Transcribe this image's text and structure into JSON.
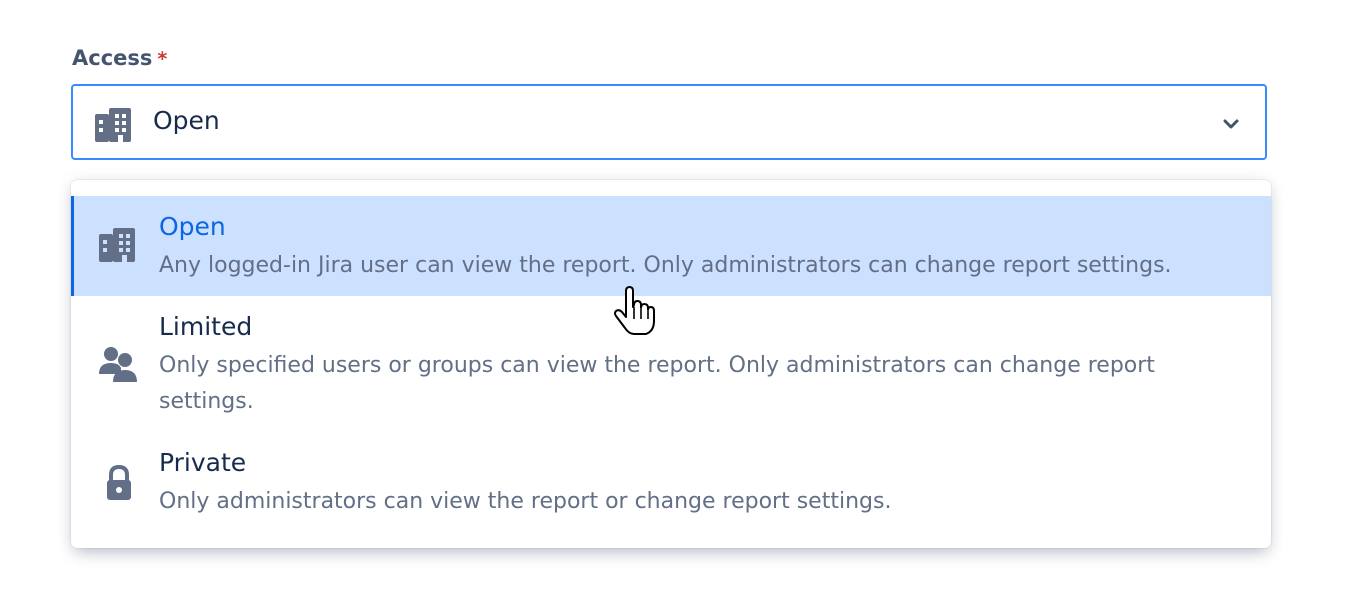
{
  "field": {
    "label": "Access",
    "required_mark": "*"
  },
  "select": {
    "value": "Open",
    "icon": "office-building-icon"
  },
  "options": [
    {
      "title": "Open",
      "description": "Any logged-in Jira user can view the report. Only administrators can change report settings.",
      "icon": "office-building-icon",
      "selected": true
    },
    {
      "title": "Limited",
      "description": "Only specified users or groups can view the report. Only administrators can change report settings.",
      "icon": "people-group-icon",
      "selected": false
    },
    {
      "title": "Private",
      "description": "Only administrators can view the report or change report settings.",
      "icon": "lock-icon",
      "selected": false
    }
  ],
  "colors": {
    "focus_border": "#388bff",
    "selected_bg": "#cce0ff",
    "selected_text": "#0c66e4",
    "text": "#172b4d",
    "subtle_text": "#626f86",
    "icon": "#626f86",
    "required": "#c9372c"
  }
}
